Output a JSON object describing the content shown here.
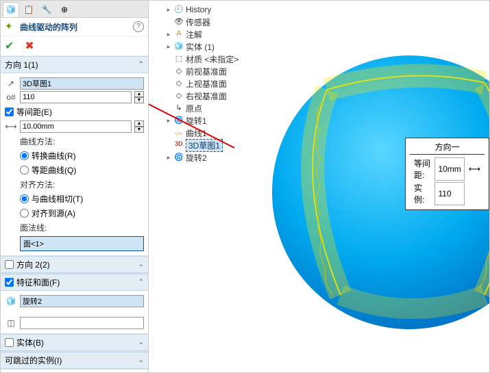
{
  "header": {
    "title": "曲线驱动的阵列"
  },
  "d1": {
    "title": "方向 1(1)",
    "curve": "3D草图1",
    "count": "110",
    "equal": "等间距(E)",
    "spacing": "10.00mm",
    "method": "曲线方法:",
    "m1": "转换曲线(R)",
    "m2": "等距曲线(Q)",
    "align": "对齐方法:",
    "a1": "与曲线相切(T)",
    "a2": "对齐到源(A)",
    "normal": "面法线:",
    "face": "面<1>"
  },
  "d2": {
    "title": "方向 2(2)"
  },
  "feat": {
    "title": "特征和面(F)",
    "item": "旋转2"
  },
  "body": {
    "title": "实体(B)"
  },
  "skip": {
    "title": "可跳过的实例(I)"
  },
  "tree": {
    "history": "History",
    "sensor": "传感器",
    "note": "注解",
    "solid": "实体 (1)",
    "material": "材质 <未指定>",
    "front": "前视基准面",
    "top": "上视基准面",
    "right": "右视基准面",
    "origin": "原点",
    "rev1": "旋转1",
    "curve1": "曲线1",
    "sk3d": "3D草图1",
    "rev2": "旋转2"
  },
  "callout": {
    "title": "方向一",
    "lab1": "等间距:",
    "v1": "10mm",
    "lab2": "实例:",
    "v2": "110"
  },
  "chart_data": null
}
